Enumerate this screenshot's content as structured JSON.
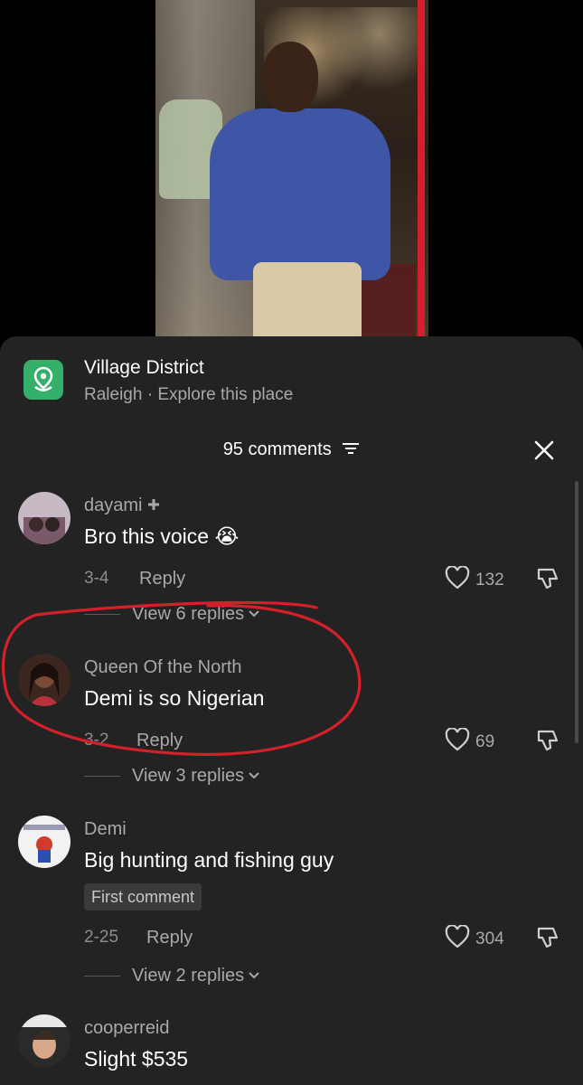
{
  "place": {
    "name": "Village District",
    "subtitle": "Raleigh · Explore this place"
  },
  "header": {
    "comments_label": "95 comments"
  },
  "comments": [
    {
      "user": "dayami",
      "text": "Bro this voice 😭",
      "date": "3-4",
      "reply": "Reply",
      "likes": "132",
      "view_replies": "View 6 replies"
    },
    {
      "user": "Queen Of the North",
      "text": "Demi is so Nigerian",
      "date": "3-2",
      "reply": "Reply",
      "likes": "69",
      "view_replies": "View 3 replies"
    },
    {
      "user": "Demi",
      "text": "Big hunting and fishing guy",
      "badge": "First comment",
      "date": "2-25",
      "reply": "Reply",
      "likes": "304",
      "view_replies": "View 2 replies"
    },
    {
      "user": "cooperreid",
      "text": "Slight $535"
    }
  ],
  "colors": {
    "sheet": "#232323",
    "place_icon": "#34b06a",
    "annotation": "#d3202a"
  },
  "icons": [
    "map-pin-icon",
    "filter-icon",
    "close-icon",
    "heart-icon",
    "dislike-icon",
    "chevron-down-icon",
    "plus-icon"
  ]
}
